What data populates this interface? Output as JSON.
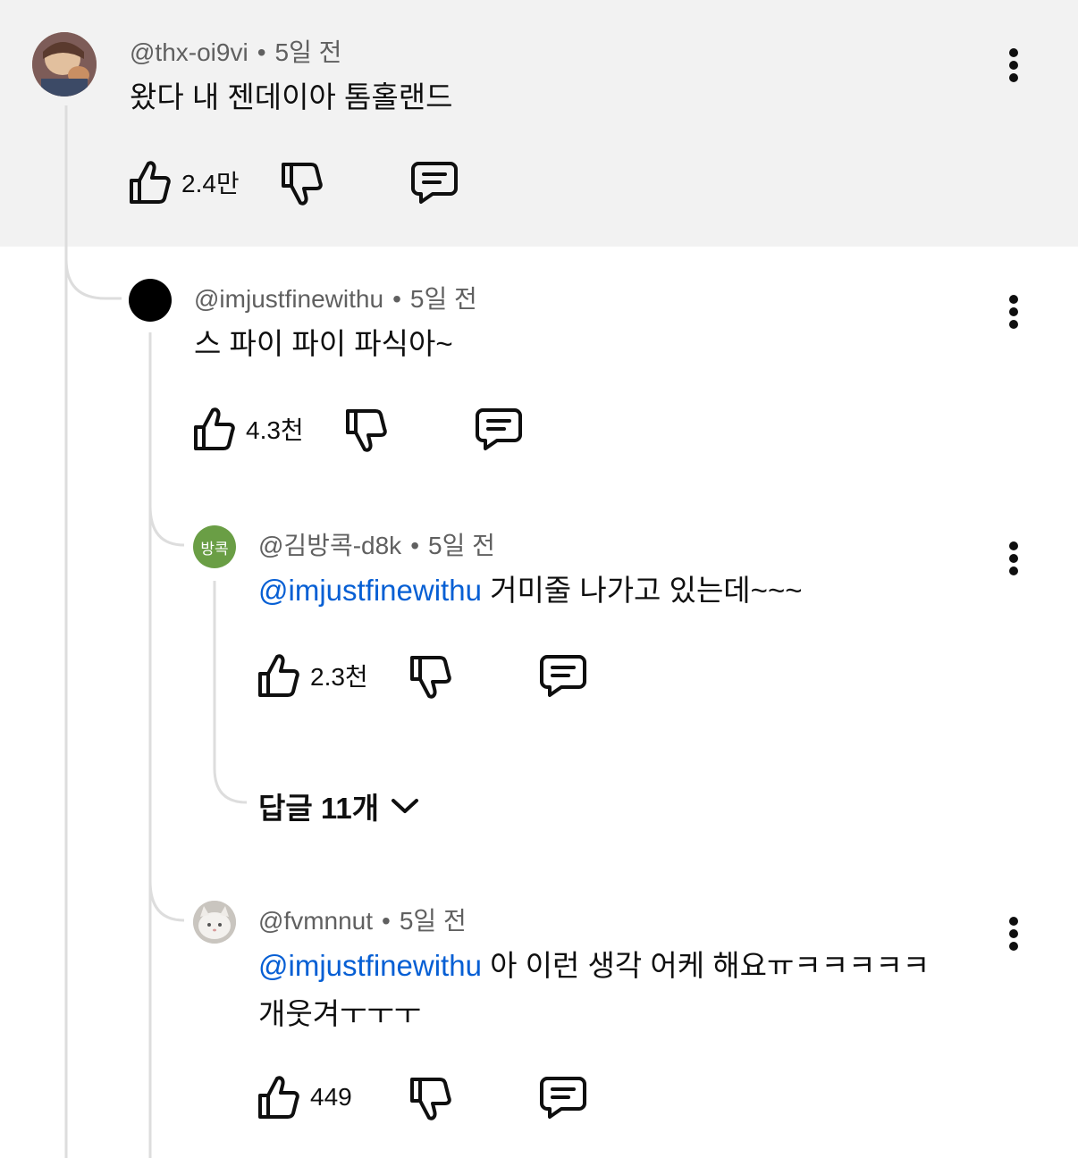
{
  "comments": [
    {
      "handle": "@thx-oi9vi",
      "sep": "•",
      "time": "5일 전",
      "text": "왔다 내 젠데이아 톰홀랜드",
      "likes": "2.4만"
    },
    {
      "handle": "@imjustfinewithu",
      "sep": "•",
      "time": "5일 전",
      "text": "스 파이 파이 파식아~",
      "likes": "4.3천"
    },
    {
      "handle": "@김방콕-d8k",
      "avatar_text": "방콕",
      "avatar_color": "#6a9e45",
      "sep": "•",
      "time": "5일 전",
      "mention": "@imjustfinewithu",
      "text": " 거미줄 나가고 있는데~~~",
      "likes": "2.3천"
    },
    {
      "handle": "@fvmnnut",
      "sep": "•",
      "time": "5일 전",
      "mention": "@imjustfinewithu",
      "text": " 아 이런 생각 어케 해요ㅠㅋㅋㅋㅋㅋ",
      "text2": "개웃겨ㅜㅜㅜ",
      "likes": "449"
    }
  ],
  "replies_toggle": {
    "label": "답글 11개"
  },
  "colors": {
    "highlight_bg": "#f2f2f2",
    "mention": "#065fd4",
    "thread_line": "#dddddd"
  },
  "icons": [
    "thumbs-up-icon",
    "thumbs-down-icon",
    "reply-icon",
    "more-vert-icon",
    "chevron-down-icon"
  ]
}
